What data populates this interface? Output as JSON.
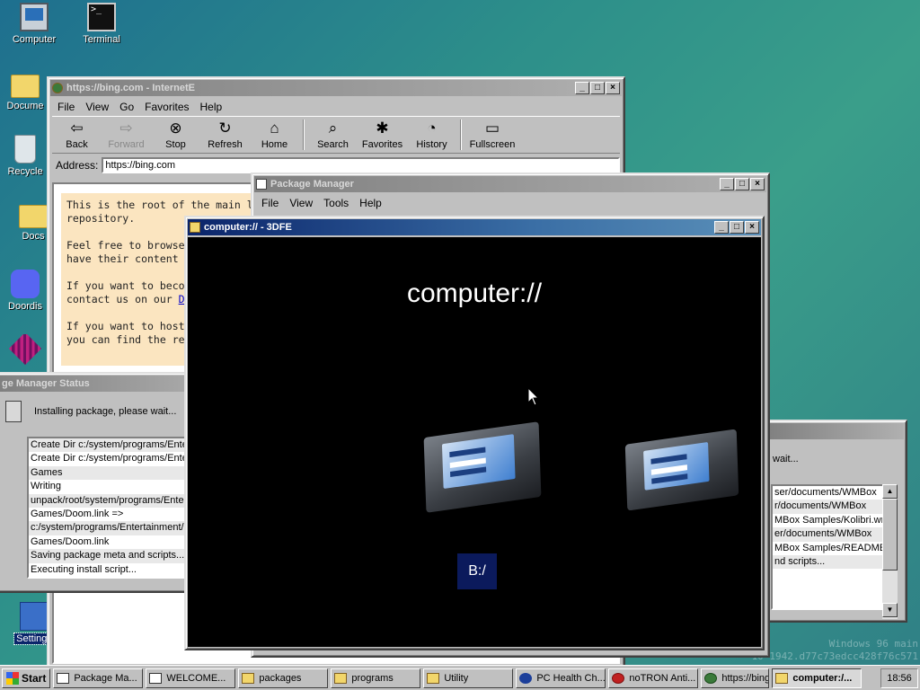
{
  "desktop": {
    "icons": [
      {
        "label": "Computer"
      },
      {
        "label": "Terminal"
      },
      {
        "label": "Docume"
      },
      {
        "label": "Recycle"
      },
      {
        "label": "Docs"
      },
      {
        "label": "Doordis"
      },
      {
        "label": "Settings"
      }
    ],
    "watermark_line1": "Windows 96 main",
    "watermark_line2": "10-1942.d77c73edcc428f76c571"
  },
  "ie_window": {
    "title": "https://bing.com - InternetE",
    "menu": [
      "File",
      "View",
      "Go",
      "Favorites",
      "Help"
    ],
    "toolbar": [
      {
        "label": "Back",
        "icon": "back-arrow-icon"
      },
      {
        "label": "Forward",
        "icon": "forward-arrow-icon"
      },
      {
        "label": "Stop",
        "icon": "stop-icon"
      },
      {
        "label": "Refresh",
        "icon": "refresh-icon"
      },
      {
        "label": "Home",
        "icon": "home-icon"
      },
      {
        "label": "Search",
        "icon": "search-icon"
      },
      {
        "label": "Favorites",
        "icon": "favorites-icon"
      },
      {
        "label": "History",
        "icon": "history-icon"
      },
      {
        "label": "Fullscreen",
        "icon": "fullscreen-icon"
      }
    ],
    "address_label": "Address:",
    "address_value": "https://bing.com",
    "content": {
      "p1a": "This is the root of the main l",
      "p1b": "repository.",
      "p2a": "Feel free to browse",
      "p2b": "have their content",
      "p3a": "If you want to beco",
      "p3b": "contact us on our ",
      "p3link": "D",
      "p4a": "If you want to host",
      "p4b": "you can find the re"
    }
  },
  "pm_window": {
    "title": "Package Manager",
    "menu": [
      "File",
      "View",
      "Tools",
      "Help"
    ]
  },
  "status_window": {
    "title": "ge Manager Status",
    "message": "Installing package, please wait...",
    "log": [
      "Create Dir c:/system/programs/Enter",
      "Create Dir c:/system/programs/Enter",
      "Games",
      "Writing",
      "unpack/root/system/programs/Ente",
      "Games/Doom.link =>",
      "c:/system/programs/Entertainment/D",
      "Games/Doom.link",
      "Saving package meta and scripts...",
      "Executing install script..."
    ]
  },
  "right_window": {
    "message": "wait...",
    "log": [
      "ser/documents/WMBox",
      "r/documents/WMBox",
      "MBox Samples/Kolibri.wmx",
      "er/documents/WMBox",
      "MBox Samples/README.md",
      "nd scripts..."
    ]
  },
  "fe_window": {
    "title": "computer:// - 3DFE",
    "heading": "computer://",
    "drive_label": "B:/"
  },
  "taskbar": {
    "start": "Start",
    "tasks": [
      {
        "label": "Package Ma..."
      },
      {
        "label": "WELCOME..."
      },
      {
        "label": "packages"
      },
      {
        "label": "programs"
      },
      {
        "label": "Utility"
      },
      {
        "label": "PC Health Ch..."
      },
      {
        "label": "noTRON Anti..."
      },
      {
        "label": "https://bing..."
      },
      {
        "label": "computer:/..."
      }
    ],
    "clock": "18:56"
  }
}
